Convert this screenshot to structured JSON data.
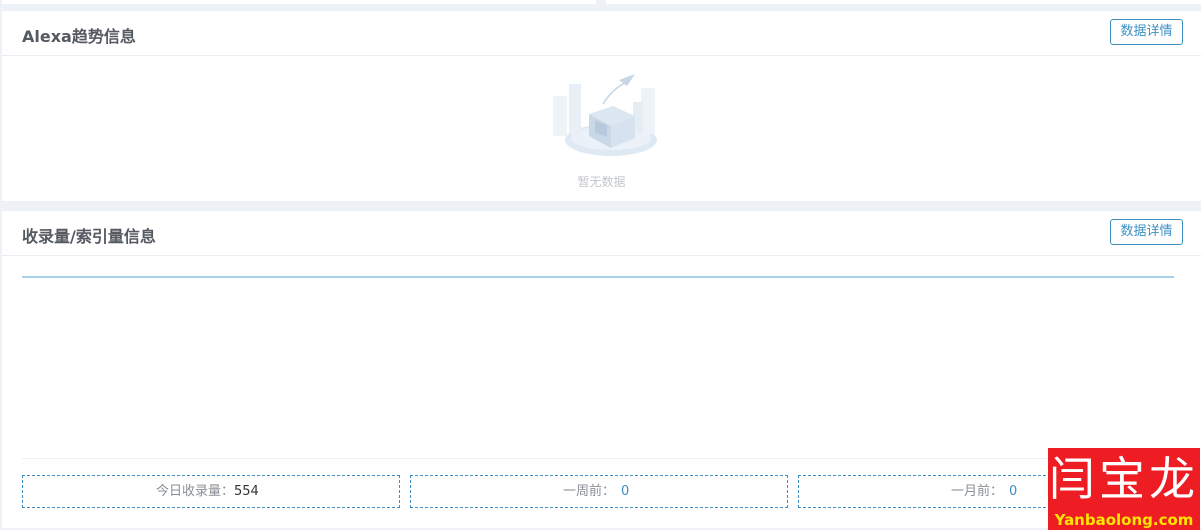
{
  "alexa_panel": {
    "title": "Alexa趋势信息",
    "detail_button": "数据详情",
    "empty_text": "暂无数据"
  },
  "index_panel": {
    "title": "收录量/索引量信息",
    "detail_button": "数据详情",
    "stats": [
      {
        "label": "今日收录量：",
        "value": "554"
      },
      {
        "label": "一周前：",
        "value": "0"
      },
      {
        "label": "一月前：",
        "value": "0"
      }
    ]
  },
  "watermark": {
    "cn": "闫宝龙",
    "en": "Yanbaolong.com"
  },
  "colors": {
    "accent": "#3d8fc4",
    "chart_line": "#a9d0ea",
    "watermark_bg": "#ee1d24",
    "watermark_en": "#ffe500"
  }
}
